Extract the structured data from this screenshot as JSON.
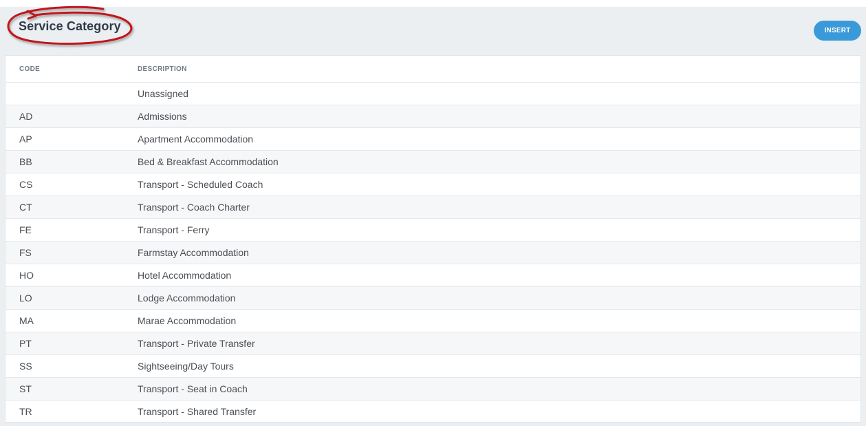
{
  "header": {
    "title": "Service Category",
    "insert_label": "INSERT"
  },
  "colors": {
    "accent": "#3a9ad9",
    "annotation": "#c0151a"
  },
  "table": {
    "columns": {
      "code": "CODE",
      "description": "DESCRIPTION"
    },
    "rows": [
      {
        "code": "",
        "description": "Unassigned"
      },
      {
        "code": "AD",
        "description": "Admissions"
      },
      {
        "code": "AP",
        "description": "Apartment Accommodation"
      },
      {
        "code": "BB",
        "description": "Bed & Breakfast Accommodation"
      },
      {
        "code": "CS",
        "description": "Transport - Scheduled Coach"
      },
      {
        "code": "CT",
        "description": "Transport - Coach Charter"
      },
      {
        "code": "FE",
        "description": "Transport - Ferry"
      },
      {
        "code": "FS",
        "description": "Farmstay Accommodation"
      },
      {
        "code": "HO",
        "description": "Hotel Accommodation"
      },
      {
        "code": "LO",
        "description": "Lodge Accommodation"
      },
      {
        "code": "MA",
        "description": "Marae Accommodation"
      },
      {
        "code": "PT",
        "description": "Transport - Private Transfer"
      },
      {
        "code": "SS",
        "description": "Sightseeing/Day Tours"
      },
      {
        "code": "ST",
        "description": "Transport - Seat in Coach"
      },
      {
        "code": "TR",
        "description": "Transport - Shared Transfer"
      }
    ]
  }
}
